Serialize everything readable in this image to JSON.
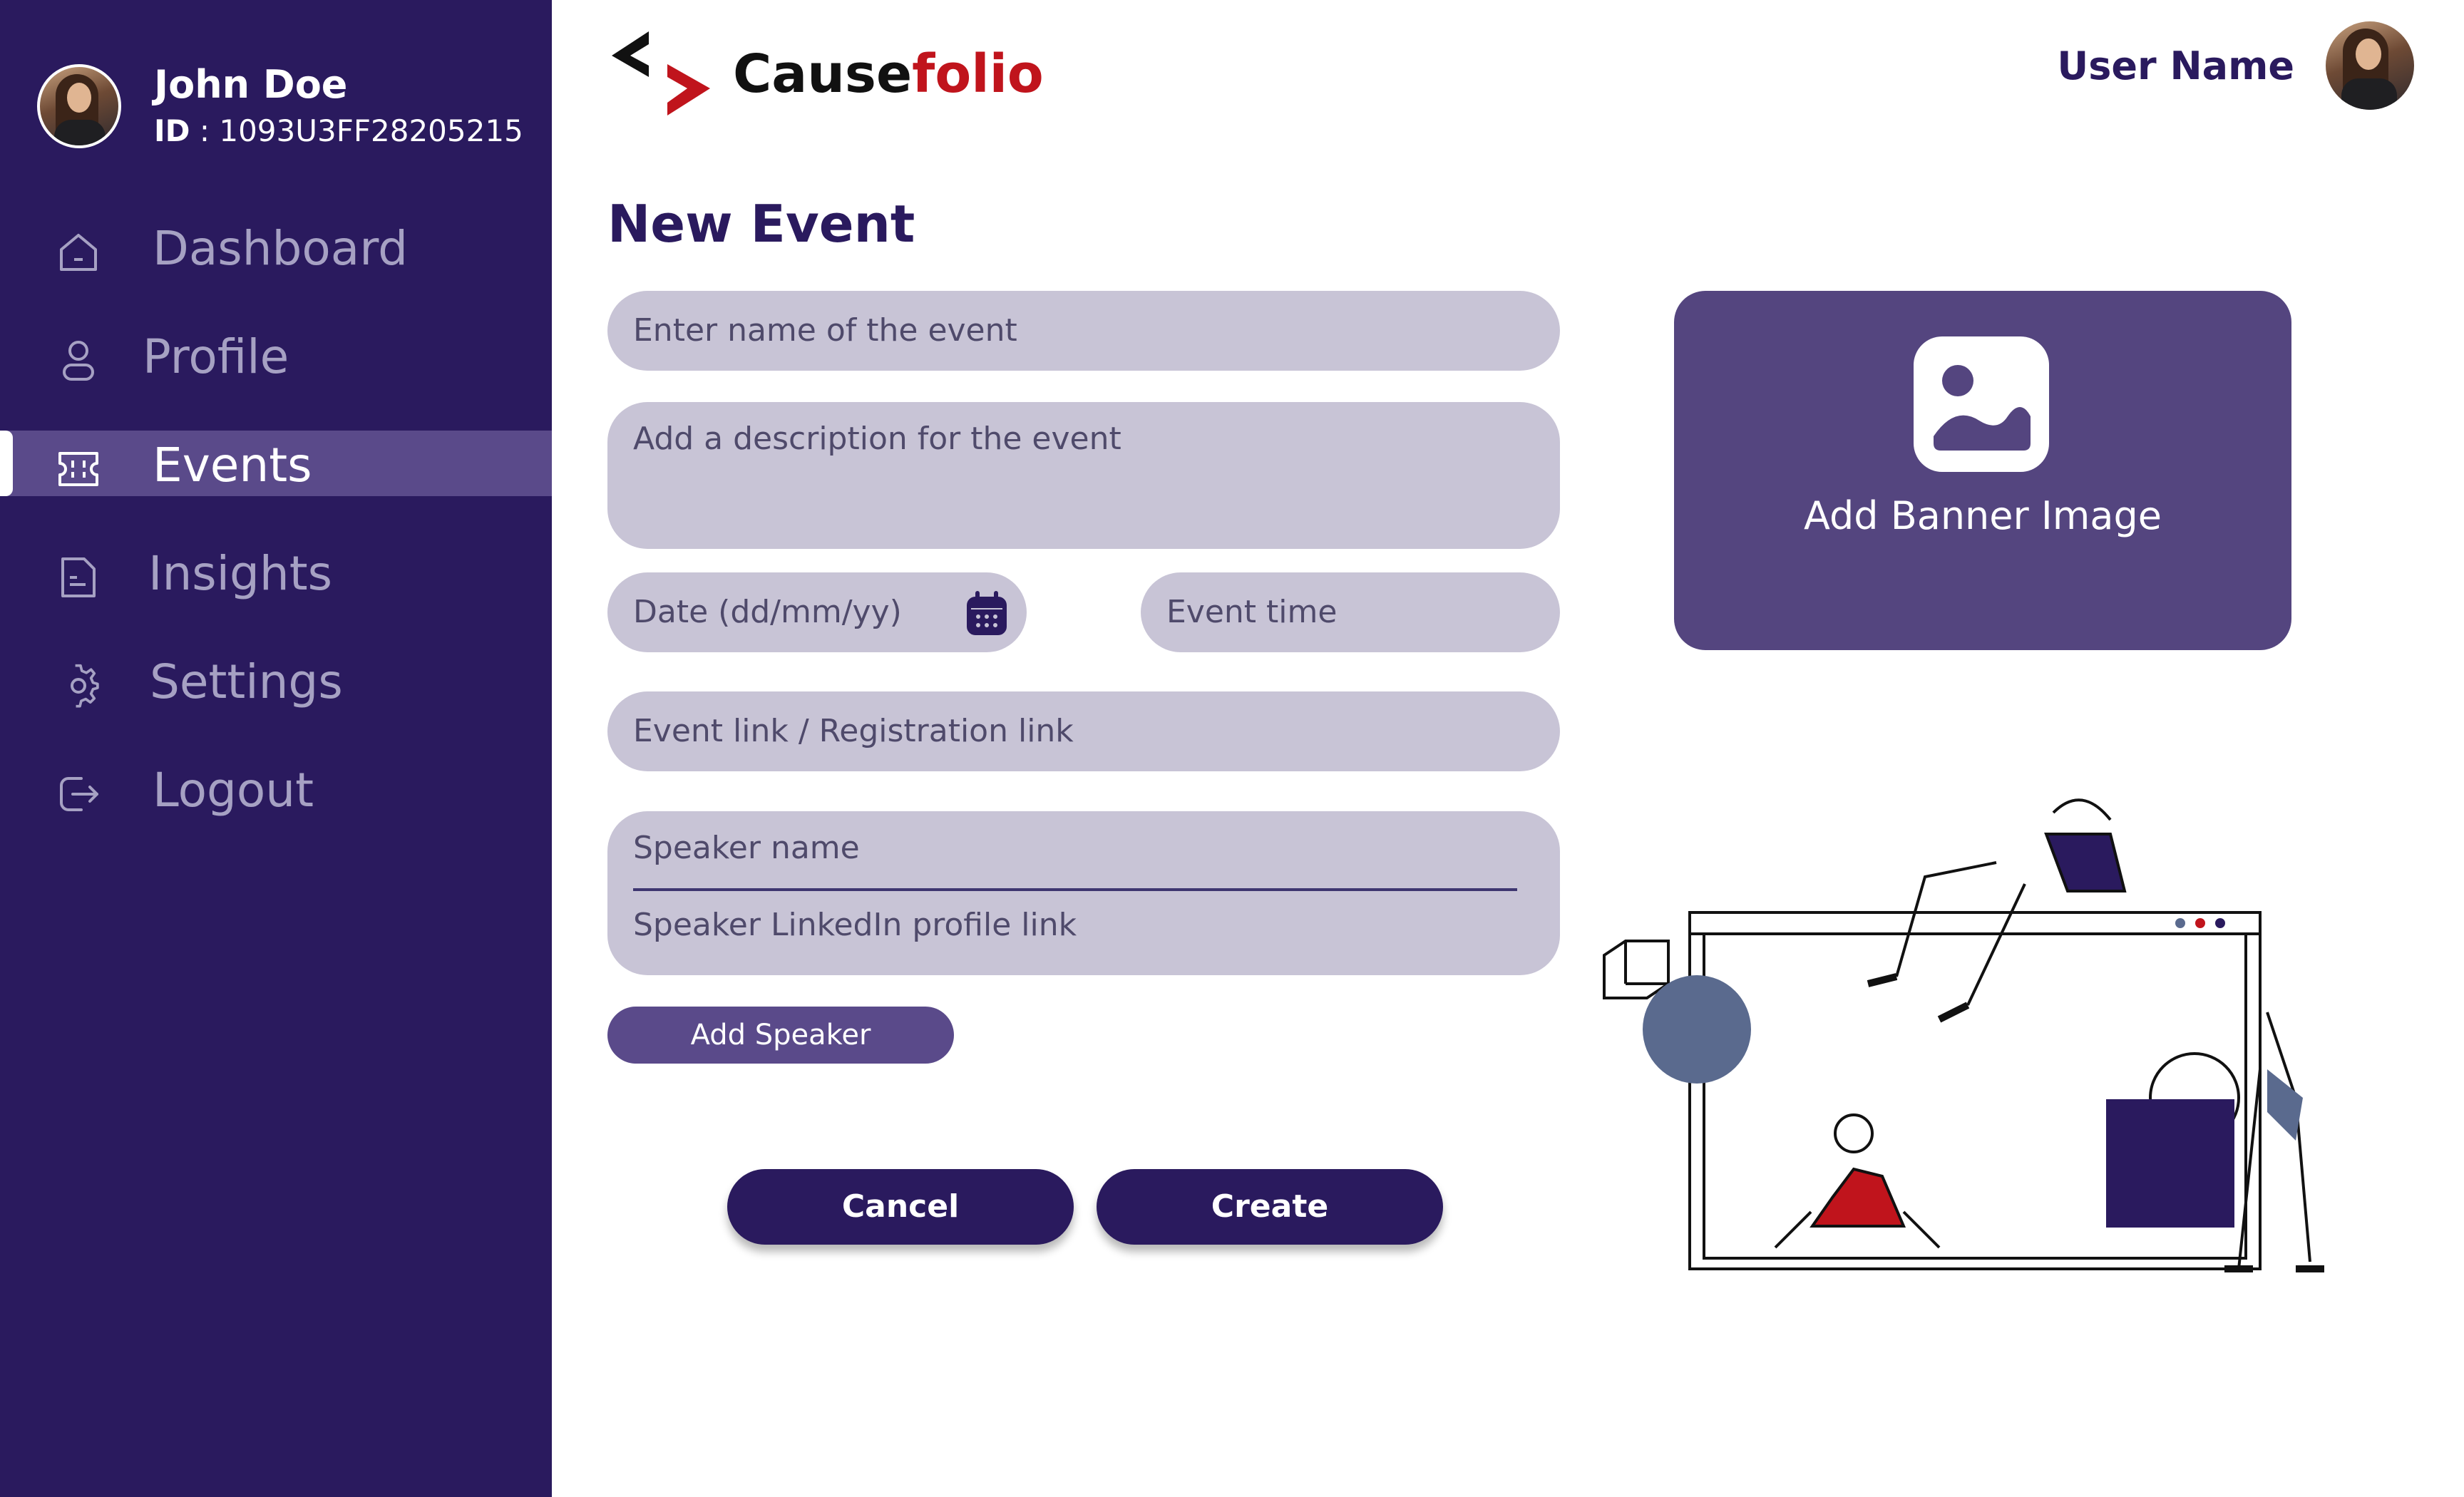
{
  "sidebar": {
    "user": {
      "name": "John Doe",
      "id_label": "ID",
      "id_value": " : 1093U3FF28205215"
    },
    "items": [
      {
        "label": "Dashboard",
        "icon": "home-icon"
      },
      {
        "label": "Profile",
        "icon": "user-icon"
      },
      {
        "label": "Events",
        "icon": "ticket-icon",
        "active": true
      },
      {
        "label": "Insights",
        "icon": "document-icon"
      },
      {
        "label": "Settings",
        "icon": "gear-icon"
      },
      {
        "label": "Logout",
        "icon": "logout-icon"
      }
    ]
  },
  "header": {
    "brand_primary": "Cause",
    "brand_accent": "folio",
    "user_name": "User Name"
  },
  "form": {
    "title": "New Event",
    "name_placeholder": "Enter name of the event",
    "description_placeholder": "Add a description for the event",
    "date_placeholder": "Date (dd/mm/yy)",
    "time_placeholder": "Event time",
    "link_placeholder": "Event link / Registration link",
    "speaker_name_placeholder": "Speaker name",
    "speaker_link_placeholder": "Speaker LinkedIn profile link",
    "add_speaker_label": "Add Speaker",
    "cancel_label": "Cancel",
    "create_label": "Create"
  },
  "banner": {
    "label": "Add Banner Image",
    "icon": "image-icon"
  },
  "colors": {
    "sidebar_bg": "#2a1a5e",
    "active_item_bg": "#5a4a8a",
    "field_bg": "#c8c4d6",
    "banner_bg": "#54457f",
    "brand_accent": "#c0141c",
    "primary_button": "#2a1a5e"
  }
}
